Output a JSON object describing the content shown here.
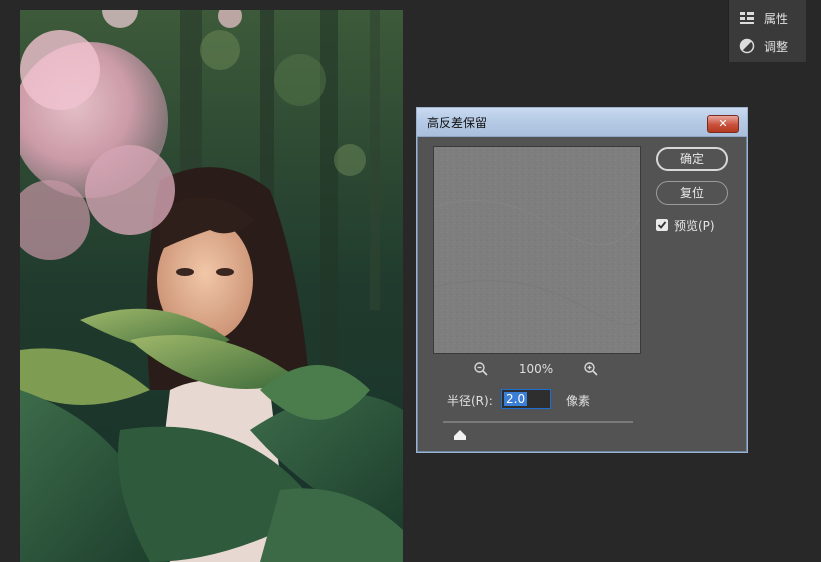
{
  "side_panel": {
    "items": [
      {
        "label": "属性",
        "icon": "properties-icon"
      },
      {
        "label": "调整",
        "icon": "adjustments-icon"
      }
    ]
  },
  "dialog": {
    "title": "高反差保留",
    "close_label": "✕",
    "ok_label": "确定",
    "reset_label": "复位",
    "preview_label": "预览(P)",
    "preview_checked": true,
    "zoom_level": "100%",
    "radius_label": "半径(R):",
    "radius_value": "2.0",
    "radius_unit": "像素"
  },
  "colors": {
    "dialog_bg": "#535353",
    "title_bar": "#b7cbe6",
    "close_button": "#c9503a",
    "selection": "#3b7ed6"
  }
}
